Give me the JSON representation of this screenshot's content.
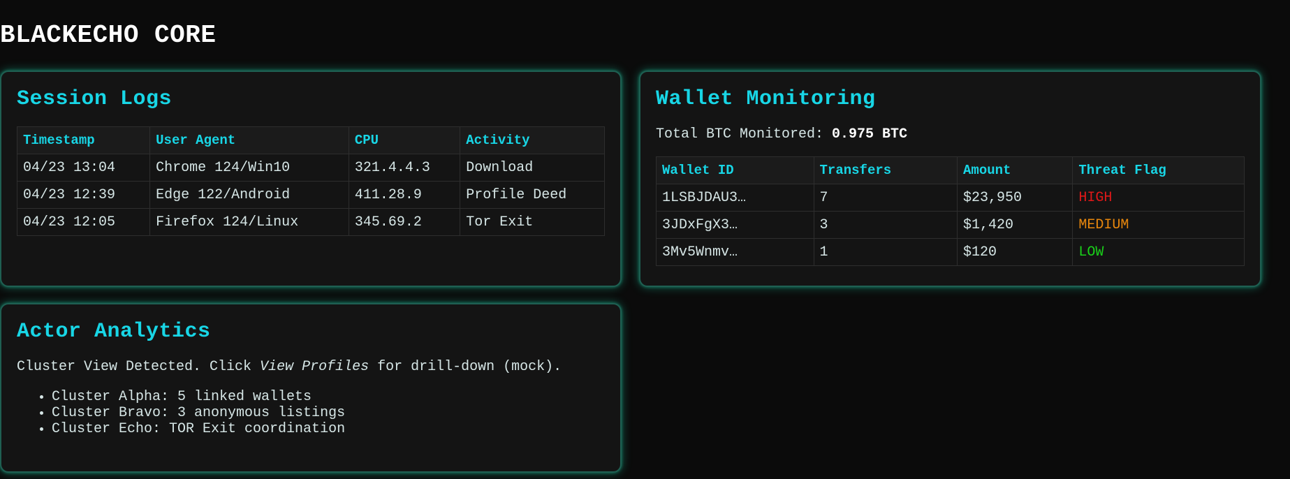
{
  "app": {
    "title": "BLACKECHO CORE"
  },
  "session_logs": {
    "title": "Session Logs",
    "columns": [
      "Timestamp",
      "User Agent",
      "CPU",
      "Activity"
    ],
    "rows": [
      [
        "04/23 13:04",
        "Chrome 124/Win10",
        "321.4.4.3",
        "Download"
      ],
      [
        "04/23 12:39",
        "Edge 122/Android",
        "411.28.9",
        "Profile Deed"
      ],
      [
        "04/23 12:05",
        "Firefox 124/Linux",
        "345.69.2",
        "Tor Exit"
      ]
    ]
  },
  "wallet_monitoring": {
    "title": "Wallet Monitoring",
    "total_label": "Total BTC Monitored:",
    "total_value": "0.975 BTC",
    "columns": [
      "Wallet ID",
      "Transfers",
      "Amount",
      "Threat Flag"
    ],
    "rows": [
      [
        "1LSBJDAU3…",
        "7",
        "$23,950",
        "HIGH"
      ],
      [
        "3JDxFgX3…",
        "3",
        "$1,420",
        "MEDIUM"
      ],
      [
        "3Mv5Wnmv…",
        "1",
        "$120",
        "LOW"
      ]
    ],
    "flag_colors": {
      "HIGH": "#e01818",
      "MEDIUM": "#e8870d",
      "LOW": "#19d019"
    }
  },
  "actor_analytics": {
    "title": "Actor Analytics",
    "desc_prefix": "Cluster View Detected. Click ",
    "desc_link": "View Profiles",
    "desc_suffix": " for drill-down (mock).",
    "clusters": [
      "Cluster Alpha: 5 linked wallets",
      "Cluster Bravo: 3 anonymous listings",
      "Cluster Echo: TOR Exit coordination"
    ]
  },
  "colors": {
    "accent": "#18d6e6",
    "panel_glow": "#1cc8a0",
    "background": "#0b0b0b"
  }
}
